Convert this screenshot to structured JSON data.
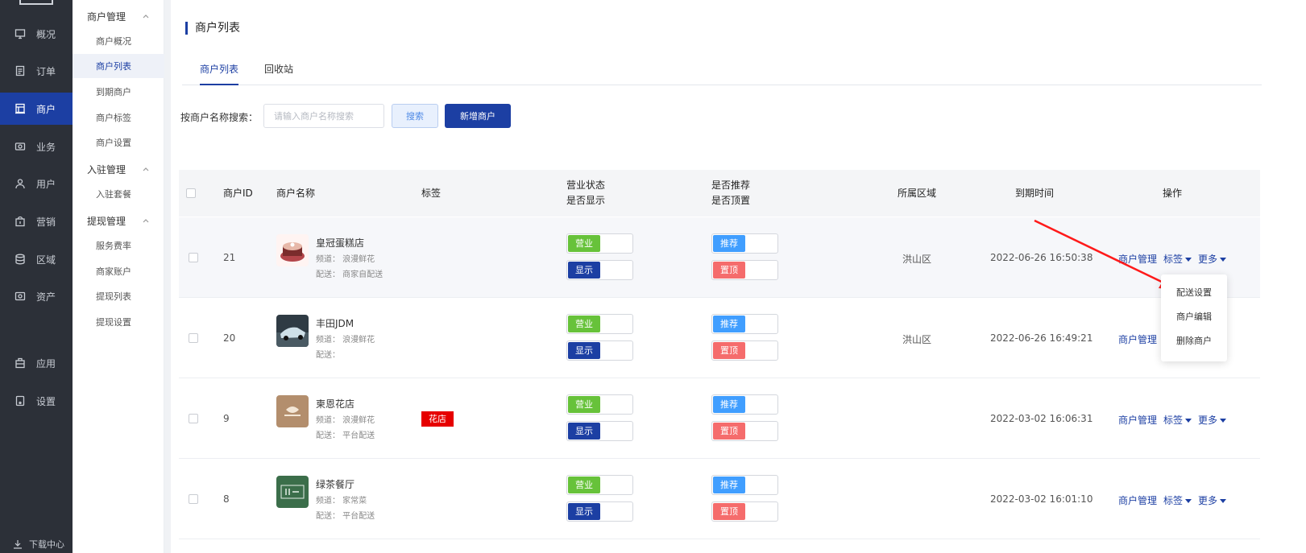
{
  "nav": {
    "items": [
      {
        "label": "概况",
        "icon": "monitor-icon"
      },
      {
        "label": "订单",
        "icon": "order-icon"
      },
      {
        "label": "商户",
        "icon": "store-icon",
        "active": true
      },
      {
        "label": "业务",
        "icon": "business-icon"
      },
      {
        "label": "用户",
        "icon": "user-icon"
      },
      {
        "label": "营销",
        "icon": "marketing-icon"
      },
      {
        "label": "区域",
        "icon": "database-icon"
      },
      {
        "label": "资产",
        "icon": "asset-icon"
      },
      {
        "label": "应用",
        "icon": "app-icon"
      },
      {
        "label": "设置",
        "icon": "settings-icon"
      }
    ],
    "download_label": "下载中心"
  },
  "subnav": {
    "groups": [
      {
        "label": "商户管理",
        "items": [
          "商户概况",
          "商户列表",
          "到期商户",
          "商户标签",
          "商户设置"
        ]
      },
      {
        "label": "入驻管理",
        "items": [
          "入驻套餐"
        ]
      },
      {
        "label": "提现管理",
        "items": [
          "服务费率",
          "商家账户",
          "提现列表",
          "提现设置"
        ]
      }
    ],
    "active_item": "商户列表"
  },
  "page": {
    "title": "商户列表",
    "tabs": [
      "商户列表",
      "回收站"
    ],
    "search_label": "按商户名称搜索：",
    "search_placeholder": "请输入商户名称搜索",
    "search_button": "搜索",
    "add_button": "新增商户"
  },
  "table": {
    "headers": {
      "id": "商户ID",
      "name": "商户名称",
      "tag": "标签",
      "status": [
        "营业状态",
        "是否显示"
      ],
      "recommend": [
        "是否推荐",
        "是否顶置"
      ],
      "region": "所属区域",
      "expire": "到期时间",
      "ops": "操作"
    },
    "rows": [
      {
        "id": "21",
        "name": "皇冠蛋糕店",
        "channel": "频道： 浪漫鲜花",
        "delivery": "配送： 商家自配送",
        "tag": "",
        "region": "洪山区",
        "expire": "2022-06-26 16:50:38"
      },
      {
        "id": "20",
        "name": "丰田JDM",
        "channel": "频道： 浪漫鲜花",
        "delivery": "配送：",
        "tag": "",
        "region": "洪山区",
        "expire": "2022-06-26 16:49:21"
      },
      {
        "id": "9",
        "name": "柬恩花店",
        "channel": "频道： 浪漫鲜花",
        "delivery": "配送： 平台配送",
        "tag": "花店",
        "region": "",
        "expire": "2022-03-02 16:06:31"
      },
      {
        "id": "8",
        "name": "绿茶餐厅",
        "channel": "频道： 家常菜",
        "delivery": "配送： 平台配送",
        "tag": "",
        "region": "",
        "expire": "2022-03-02 16:01:10"
      }
    ],
    "toggle_labels": {
      "open": "营业",
      "show": "显示",
      "recommend": "推荐",
      "top": "置顶"
    },
    "op_labels": {
      "manage": "商户管理",
      "tag": "标签",
      "more": "更多"
    }
  },
  "dropdown": {
    "items": [
      "配送设置",
      "商户编辑",
      "删除商户"
    ]
  },
  "colors": {
    "nav_bg": "#2c3038",
    "accent": "#1c3fa3",
    "green": "#67c23a",
    "blue": "#409eff",
    "red": "#f56c6c",
    "tag_red": "#e60000",
    "arrow_red": "#ff1a1a"
  }
}
